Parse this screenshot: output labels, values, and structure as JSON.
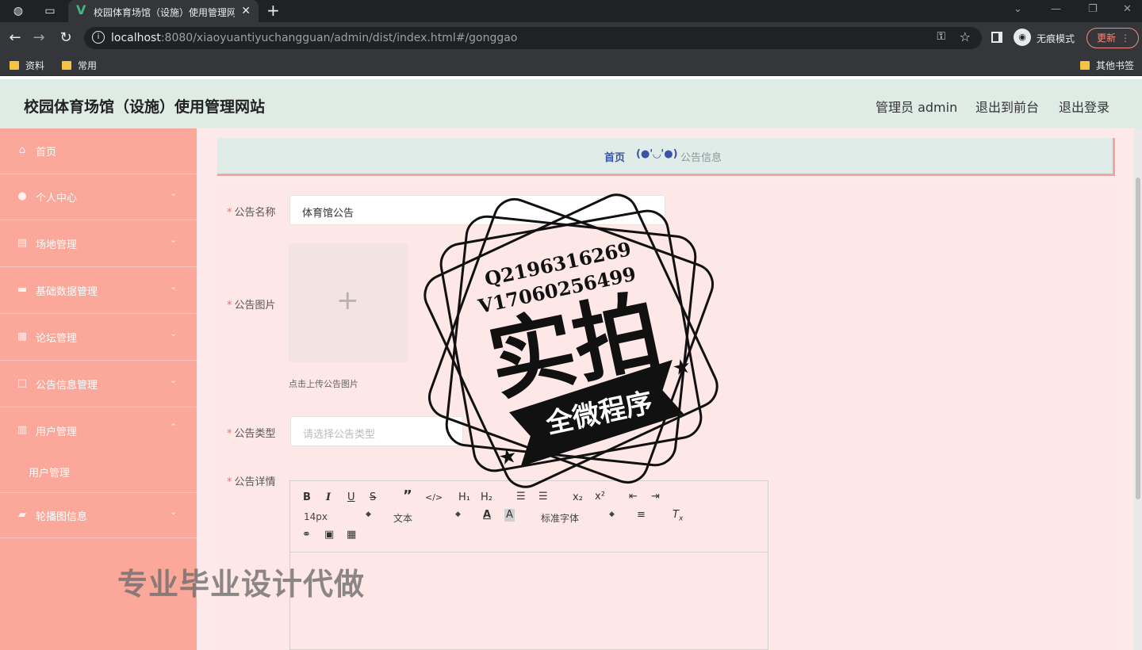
{
  "browser": {
    "tab_title": "校园体育场馆（设施）使用管理网站",
    "url_host": "localhost",
    "url_rest": ":8080/xiaoyuantiyuchangguan/admin/dist/index.html#/gonggao",
    "incognito_label": "无痕模式",
    "update_label": "更新",
    "bookmarks": [
      "资料",
      "常用"
    ],
    "other_bookmarks": "其他书签"
  },
  "header": {
    "title": "校园体育场馆（设施）使用管理网站",
    "user": "管理员 admin",
    "front_link": "退出到前台",
    "logout": "退出登录"
  },
  "sidebar": {
    "items": [
      {
        "label": "首页",
        "icon": "home-icon"
      },
      {
        "label": "个人中心",
        "icon": "user-icon"
      },
      {
        "label": "场地管理",
        "icon": "document-icon"
      },
      {
        "label": "基础数据管理",
        "icon": "ticket-icon"
      },
      {
        "label": "论坛管理",
        "icon": "grid-icon"
      },
      {
        "label": "公告信息管理",
        "icon": "square-icon"
      },
      {
        "label": "用户管理",
        "icon": "bar-chart-icon"
      },
      {
        "label": "轮播图信息",
        "icon": "briefcase-icon"
      }
    ],
    "sub_items": [
      "用户管理"
    ]
  },
  "breadcrumb": {
    "home": "首页",
    "separator": "(●'◡'●)",
    "current": "公告信息"
  },
  "form": {
    "name_label": "公告名称",
    "name_value": "体育馆公告",
    "image_label": "公告图片",
    "upload_hint": "点击上传公告图片",
    "type_label": "公告类型",
    "type_placeholder": "请选择公告类型",
    "detail_label": "公告详情"
  },
  "editor": {
    "size_value": "14px",
    "format_value": "文本",
    "font_value": "标准字体"
  },
  "watermark": "专业毕业设计代做",
  "stamp": {
    "line1": "Q2196316269",
    "line2": "V17060256499",
    "main": "实拍",
    "banner": "全微程序"
  },
  "colors": {
    "sidebar": "#fba79a",
    "header": "#dfece6",
    "content": "#fde9e9",
    "accent": "#3a53a6"
  }
}
